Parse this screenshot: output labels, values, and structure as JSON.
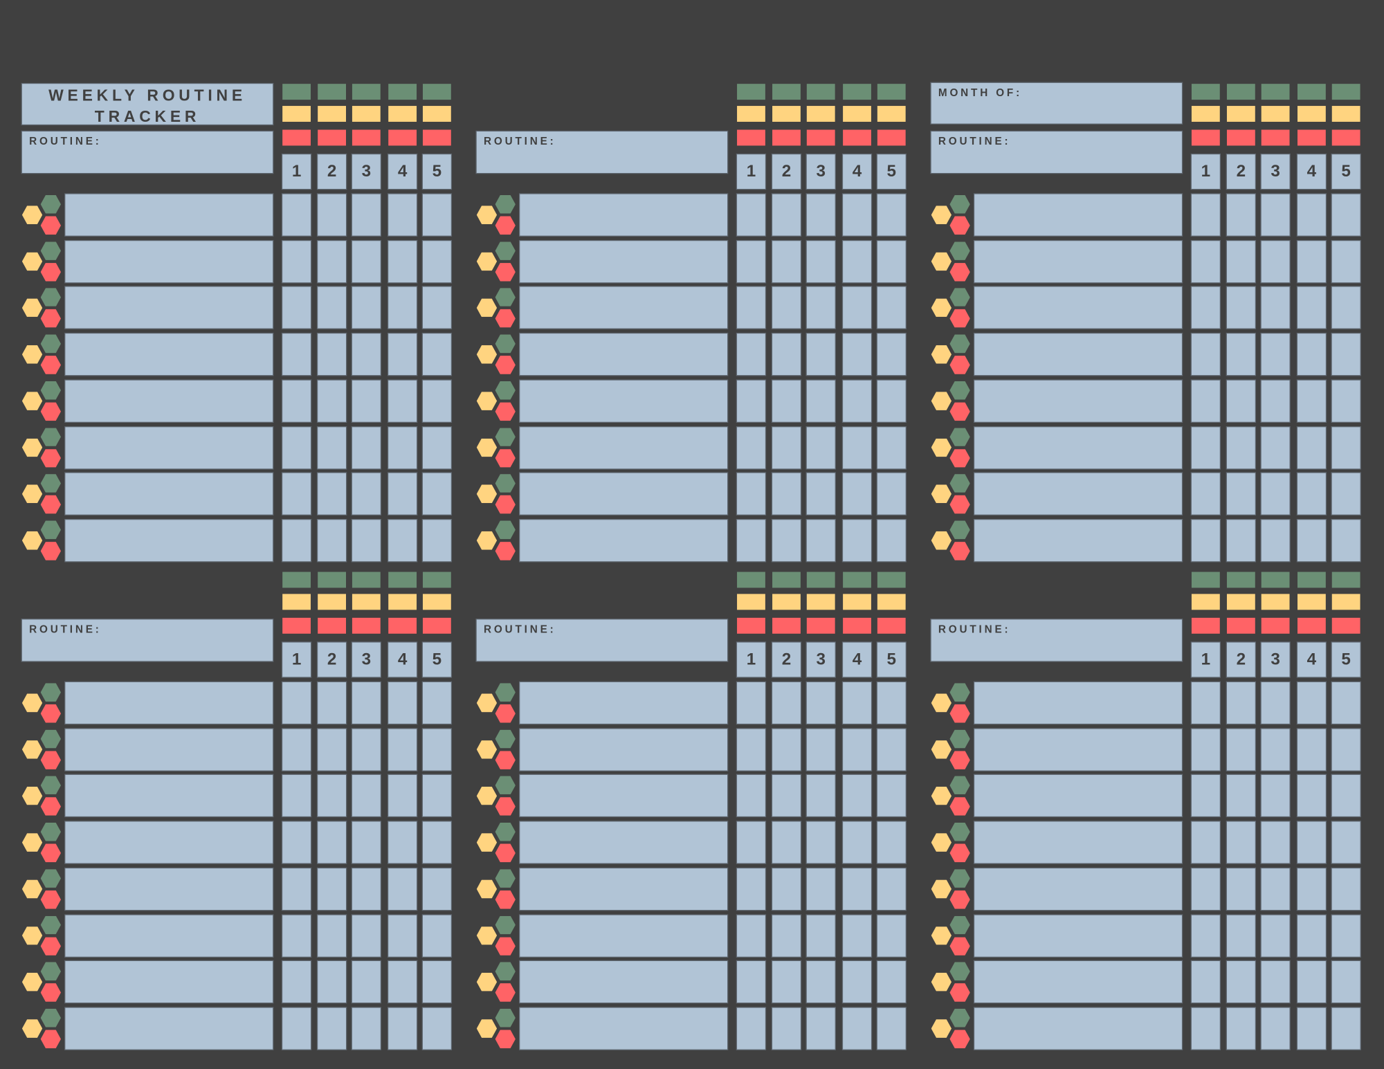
{
  "colors": {
    "background": "#404040",
    "box": "#b1c4d6",
    "green": "#6b8f75",
    "yellow": "#ffd480",
    "red": "#ff6366",
    "text": "#404040"
  },
  "title_lines": [
    "WEEKLY ROUTINE",
    "TRACKER"
  ],
  "month_label": "MONTH OF:",
  "days": [
    "1",
    "2",
    "3",
    "4",
    "5"
  ],
  "panels": [
    {
      "header": "title",
      "routine_label": "ROUTINE:",
      "rows": 8
    },
    {
      "header": "none",
      "routine_label": "ROUTINE:",
      "rows": 8
    },
    {
      "header": "month",
      "routine_label": "ROUTINE:",
      "rows": 8
    },
    {
      "header": "none",
      "routine_label": "ROUTINE:",
      "rows": 8
    },
    {
      "header": "none",
      "routine_label": "ROUTINE:",
      "rows": 8
    },
    {
      "header": "none",
      "routine_label": "ROUTINE:",
      "rows": 8
    }
  ],
  "icons": {
    "row_marker": "hexagon-cluster-icon"
  }
}
